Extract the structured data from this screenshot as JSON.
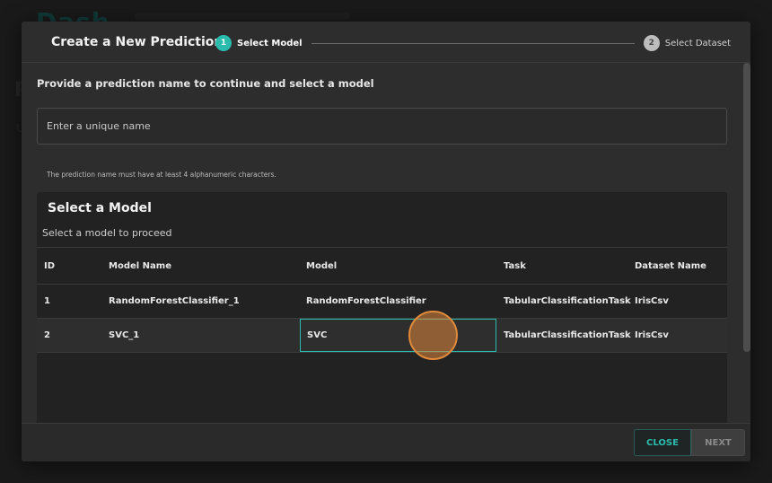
{
  "background": {
    "logo_text": "Dash",
    "partial_letter_1": "P",
    "partial_letter_2": "U"
  },
  "modal": {
    "title": "Create a New Prediction",
    "steps": [
      {
        "number": "1",
        "label": "Select Model",
        "state": "active"
      },
      {
        "number": "2",
        "label": "Select Dataset",
        "state": "inactive"
      }
    ],
    "prompt": "Provide a prediction name to continue and select a model",
    "name_input": {
      "placeholder": "Enter a unique name",
      "value": ""
    },
    "helper_text": "The prediction name must have at least 4 alphanumeric characters.",
    "model_panel": {
      "title": "Select a Model",
      "subtitle": "Select a model to proceed",
      "columns": [
        "ID",
        "Model Name",
        "Model",
        "Task",
        "Dataset Name"
      ],
      "rows": [
        {
          "id": "1",
          "model_name": "RandomForestClassifier_1",
          "model": "RandomForestClassifier",
          "task": "TabularClassificationTask",
          "dataset": "IrisCsv"
        },
        {
          "id": "2",
          "model_name": "SVC_1",
          "model": "SVC",
          "task": "TabularClassificationTask",
          "dataset": "IrisCsv"
        }
      ]
    },
    "footer": {
      "close_label": "CLOSE",
      "next_label": "NEXT"
    }
  },
  "colors": {
    "accent": "#2bbbad",
    "cursor": "#e08a3c"
  }
}
